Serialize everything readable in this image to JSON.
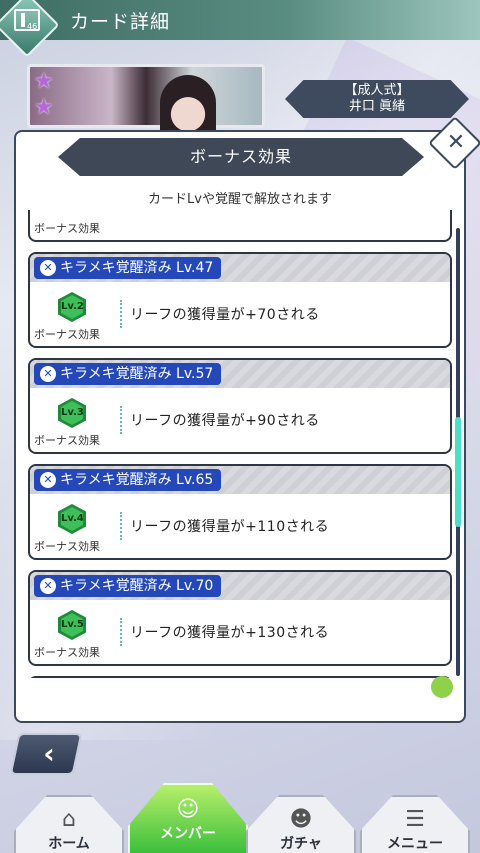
{
  "header": {
    "title": "カード詳細",
    "icon_number": "46"
  },
  "card": {
    "name_line1": "【成人式】",
    "name_line2": "井口 眞緒"
  },
  "modal": {
    "title": "ボーナス効果",
    "subtitle": "カードLvや覚醒で解放されます",
    "close_icon": "✕"
  },
  "bonus_label": "ボーナス効果",
  "bonus_items": [
    {
      "title": "キラメキ覚醒済み Lv.47",
      "level": "Lv.2",
      "effect": "リーフの獲得量が+70される"
    },
    {
      "title": "キラメキ覚醒済み Lv.57",
      "level": "Lv.3",
      "effect": "リーフの獲得量が+90される"
    },
    {
      "title": "キラメキ覚醒済み Lv.65",
      "level": "Lv.4",
      "effect": "リーフの獲得量が+110される"
    },
    {
      "title": "キラメキ覚醒済み Lv.70",
      "level": "Lv.5",
      "effect": "リーフの獲得量が+130される"
    }
  ],
  "nav": {
    "home": "ホーム",
    "member": "メンバー",
    "gacha": "ガチャ",
    "menu": "メニュー"
  },
  "colors": {
    "accent_blue": "#2548b8",
    "level_green": "#3fbf5a",
    "header_teal": "#3f6d64",
    "scroll_cyan": "#4be0c6"
  }
}
